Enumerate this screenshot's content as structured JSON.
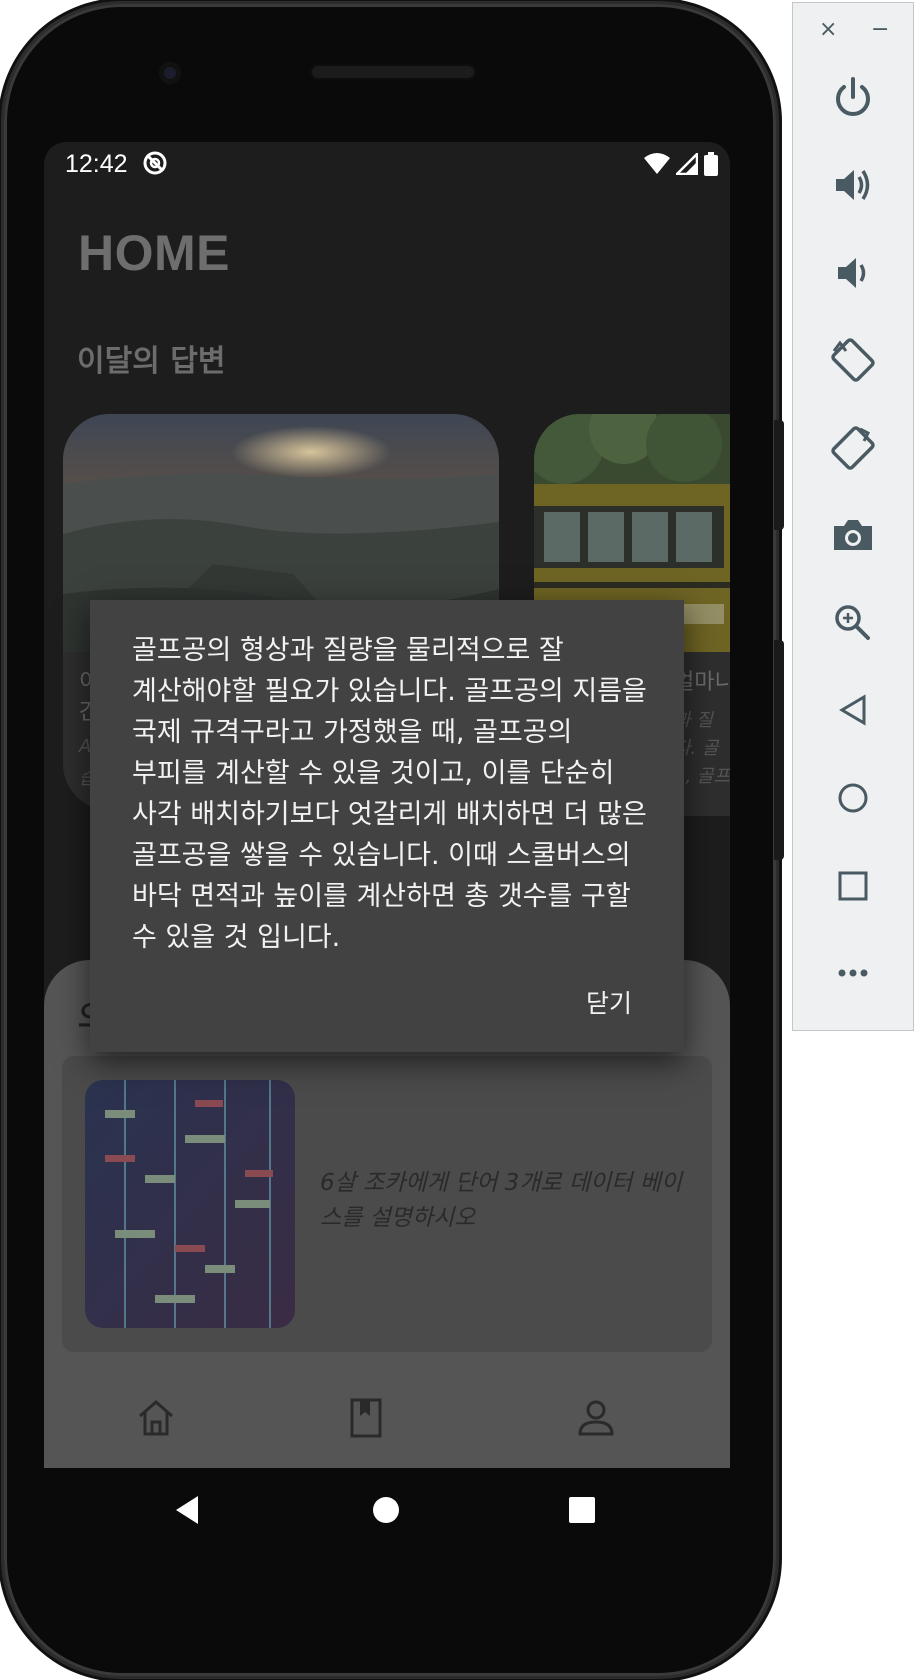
{
  "status_bar": {
    "time": "12:42"
  },
  "home": {
    "title": "HOME",
    "section_title": "이달의 답변",
    "cards": [
      {
        "title_fragment": "이",
        "title_fragment2": "간",
        "subtitle_fragment": "A",
        "subtitle_fragment2": "습"
      },
      {
        "title_fragment": "얼마니",
        "subtitle_fragment": "과 질",
        "subtitle_fragment2": "다. 골",
        "subtitle_fragment3": "1, 골프"
      }
    ]
  },
  "bottom_sheet": {
    "title_fragment": "오",
    "question": "6살 조카에게 단어 3개로 데이터 베이스를 설명하시오"
  },
  "dialog": {
    "body": "골프공의 형상과 질량을 물리적으로 잘 계산해야할 필요가 있습니다. 골프공의 지름을 국제 규격구라고 가정했을 때, 골프공의 부피를 계산할 수 있을 것이고, 이를 단순히 사각 배치하기보다 엇갈리게 배치하면 더 많은 골프공을 쌓을 수 있습니다. 이때 스쿨버스의 바닥 면적과 높이를 계산하면 총 갯수를 구할 수 있을 것 입니다.",
    "close_label": "닫기"
  },
  "bottom_nav": {
    "icons": [
      "home-icon",
      "book-icon",
      "person-icon"
    ]
  },
  "emulator_panel": {
    "close_glyph": "×",
    "minimize_glyph": "−",
    "icons": [
      "power-icon",
      "volume-up-icon",
      "volume-down-icon",
      "rotate-left-icon",
      "rotate-right-icon",
      "camera-icon",
      "zoom-icon",
      "back-icon",
      "home-icon",
      "overview-icon",
      "more-icon"
    ]
  },
  "colors": {
    "dialog_bg": "#424242",
    "screen_bg": "#1d1d1d",
    "sheet_bg": "#555555",
    "emulator_icon": "#4a5a63"
  }
}
